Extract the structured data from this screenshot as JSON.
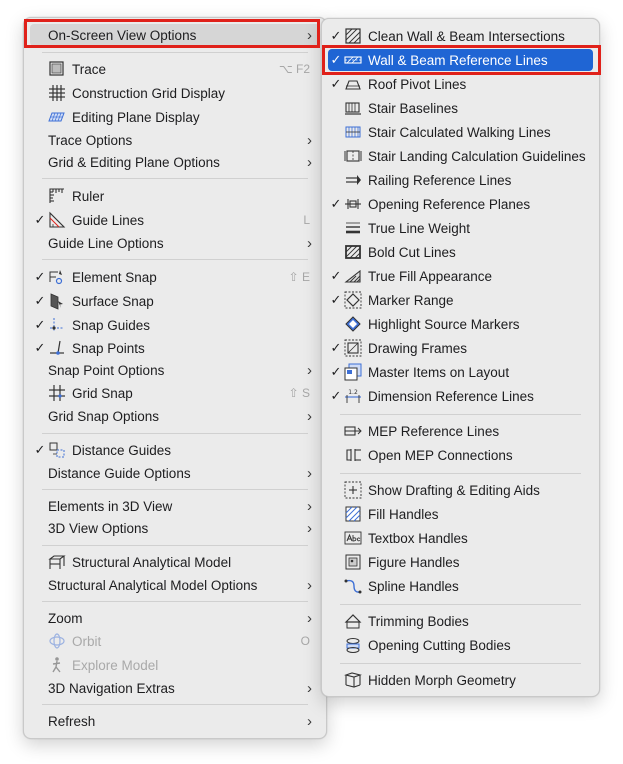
{
  "left_menu": {
    "on_screen_view_options": "On-Screen View Options",
    "trace": "Trace",
    "trace_shortcut": "⌥ F2",
    "construction_grid_display": "Construction Grid Display",
    "editing_plane_display": "Editing Plane Display",
    "trace_options": "Trace Options",
    "grid_editing_plane_options": "Grid & Editing Plane Options",
    "ruler": "Ruler",
    "guide_lines": "Guide Lines",
    "guide_lines_shortcut": "L",
    "guide_line_options": "Guide Line Options",
    "element_snap": "Element Snap",
    "element_snap_shortcut": "⇧ E",
    "surface_snap": "Surface Snap",
    "snap_guides": "Snap Guides",
    "snap_points": "Snap Points",
    "snap_point_options": "Snap Point Options",
    "grid_snap": "Grid Snap",
    "grid_snap_shortcut": "⇧ S",
    "grid_snap_options": "Grid Snap Options",
    "distance_guides": "Distance Guides",
    "distance_guide_options": "Distance Guide Options",
    "elements_in_3d_view": "Elements in 3D View",
    "view_3d_options": "3D View Options",
    "structural_analytical_model": "Structural Analytical Model",
    "structural_analytical_model_options": "Structural Analytical Model Options",
    "zoom": "Zoom",
    "orbit": "Orbit",
    "orbit_shortcut": "O",
    "explore_model": "Explore Model",
    "navigation_extras": "3D Navigation Extras",
    "refresh": "Refresh"
  },
  "right_menu": {
    "clean_wall_beam": "Clean Wall & Beam Intersections",
    "wall_beam_reference": "Wall & Beam Reference Lines",
    "roof_pivot": "Roof Pivot Lines",
    "stair_baselines": "Stair Baselines",
    "stair_walking": "Stair Calculated Walking Lines",
    "stair_landing": "Stair Landing Calculation Guidelines",
    "railing_reference": "Railing Reference Lines",
    "opening_reference": "Opening Reference Planes",
    "true_line_weight": "True Line Weight",
    "bold_cut_lines": "Bold Cut Lines",
    "true_fill": "True Fill Appearance",
    "marker_range": "Marker Range",
    "highlight_source": "Highlight Source Markers",
    "drawing_frames": "Drawing Frames",
    "master_items": "Master Items on Layout",
    "dimension_reference": "Dimension Reference Lines",
    "mep_reference": "MEP Reference Lines",
    "open_mep": "Open MEP Connections",
    "show_drafting": "Show Drafting & Editing Aids",
    "fill_handles": "Fill Handles",
    "textbox_handles": "Textbox Handles",
    "figure_handles": "Figure Handles",
    "spline_handles": "Spline Handles",
    "trimming_bodies": "Trimming Bodies",
    "opening_cutting": "Opening Cutting Bodies",
    "hidden_morph": "Hidden Morph Geometry"
  },
  "symbols": {
    "check": "✓",
    "submenu_arrow": "›",
    "dimension_value": "1.2"
  },
  "colors": {
    "highlight_blue": "#1f65d4",
    "annotation_red": "#e0211a",
    "icon_blue": "#3d6fd6"
  }
}
